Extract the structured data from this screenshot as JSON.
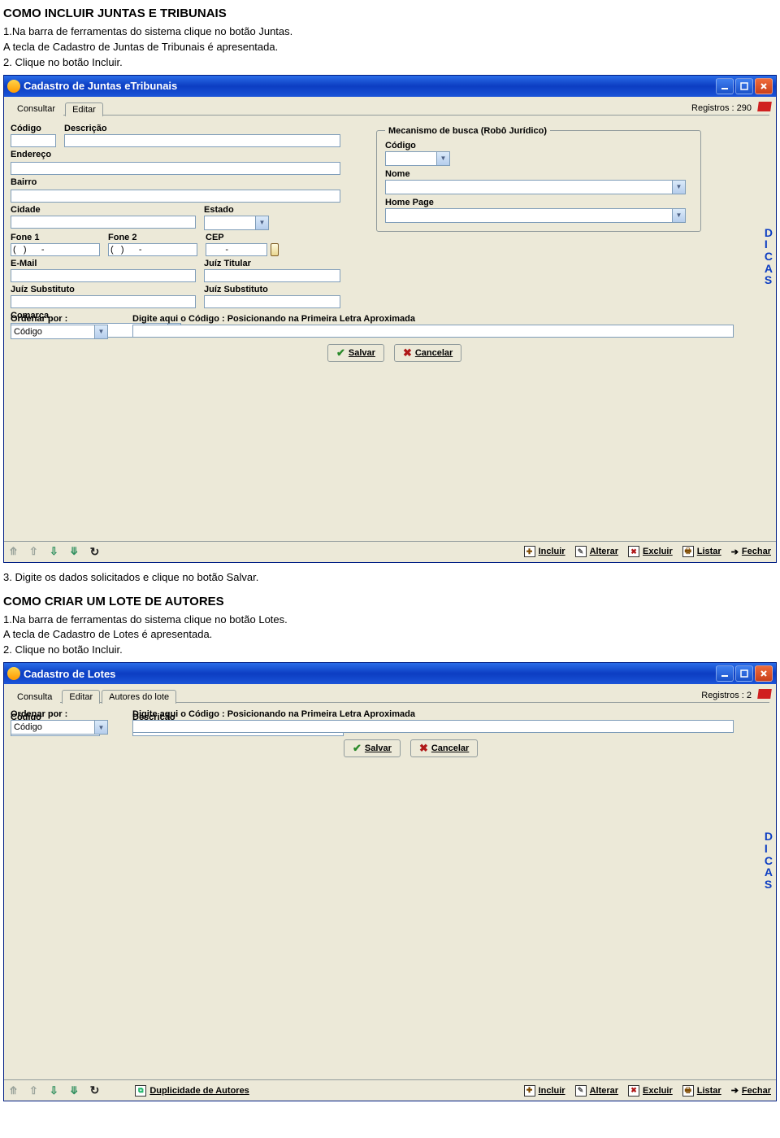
{
  "headings": {
    "title1": "COMO INCLUIR JUNTAS E TRIBUNAIS",
    "step1_1": "1.Na barra de ferramentas do sistema clique no botão Juntas.",
    "step1_2": "A tecla de Cadastro de Juntas de Tribunais é apresentada.",
    "step1_3": "2. Clique no botão Incluir.",
    "after1": "3. Digite os dados solicitados e clique no botão Salvar.",
    "title2": "COMO CRIAR UM LOTE DE AUTORES",
    "step2_1": "1.Na barra de ferramentas do sistema clique no botão Lotes.",
    "step2_2": "A tecla de Cadastro de Lotes é apresentada.",
    "step2_3": "2. Clique no botão Incluir."
  },
  "win1": {
    "title": "Cadastro de Juntas  eTribunais",
    "tabs": {
      "consultar": "Consultar",
      "editar": "Editar"
    },
    "registros": "Registros : 290",
    "labels": {
      "codigo": "Código",
      "descricao": "Descrição",
      "endereco": "Endereço",
      "bairro": "Bairro",
      "cidade": "Cidade",
      "estado": "Estado",
      "fone1": "Fone 1",
      "fone2": "Fone 2",
      "cep": "CEP",
      "email": "E-Mail",
      "juiz_titular": "Juíz Titular",
      "juiz_sub1": "Juíz Substituto",
      "juiz_sub2": "Juíz Substituto",
      "comarca": "Comarca",
      "mecanismo": "Mecanismo de busca (Robô Jurídico)",
      "nome": "Nome",
      "homepage": "Home Page"
    },
    "values": {
      "fone1": "(   )      -",
      "fone2": "(   )      -",
      "cep": "       -"
    },
    "buttons": {
      "salvar": "Salvar",
      "cancelar": "Cancelar"
    },
    "dicas": {
      "d": "D",
      "i": "I",
      "c": "C",
      "a": "A",
      "s": "S"
    },
    "ordenar": {
      "label": "Ordenar por :",
      "value": "Código",
      "digite": "Digite aqui o Código : Posicionando na Primeira Letra Aproximada"
    },
    "footer": {
      "incluir": "Incluir",
      "alterar": "Alterar",
      "excluir": "Excluir",
      "listar": "Listar",
      "fechar": "Fechar"
    }
  },
  "win2": {
    "title": "Cadastro de Lotes",
    "tabs": {
      "consulta": "Consulta",
      "editar": "Editar",
      "autores": "Autores do lote"
    },
    "registros": "Registros : 2",
    "labels": {
      "codigo": "Código",
      "descricao": "Descrição"
    },
    "buttons": {
      "salvar": "Salvar",
      "cancelar": "Cancelar"
    },
    "dicas": {
      "d": "D",
      "i": "I",
      "c": "C",
      "a": "A",
      "s": "S"
    },
    "ordenar": {
      "label": "Ordenar por :",
      "value": "Código",
      "digite": "Digite aqui o Código : Posicionando na Primeira Letra Aproximada"
    },
    "footer": {
      "dup": "Duplicidade de Autores",
      "incluir": "Incluir",
      "alterar": "Alterar",
      "excluir": "Excluir",
      "listar": "Listar",
      "fechar": "Fechar"
    }
  }
}
